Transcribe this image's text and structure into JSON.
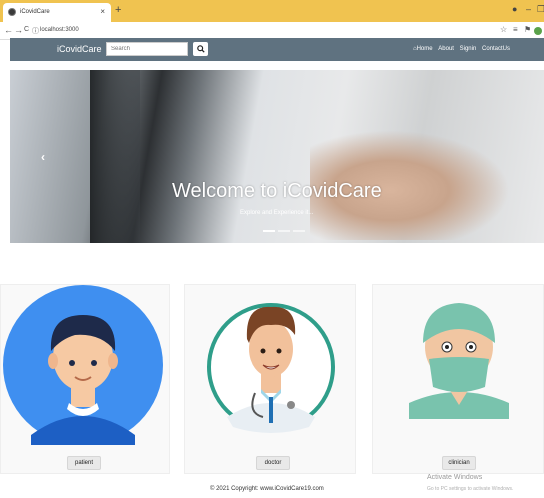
{
  "browser": {
    "tab_title": "iCovidCare",
    "tab_close": "×",
    "new_tab": "+",
    "url": "localhost:3000",
    "back": "←",
    "forward": "→",
    "reload": "C",
    "info": "ⓘ"
  },
  "navbar": {
    "brand": "iCovidCare",
    "search_placeholder": "Search",
    "search_button_icon": "search-icon",
    "links": [
      "Home",
      "About",
      "Signin",
      "ContactUs"
    ],
    "home_icon": "home-icon"
  },
  "carousel": {
    "title": "Welcome to iCovidCare",
    "subtitle": "Explore and Experience it...",
    "prev": "‹"
  },
  "cards": [
    {
      "label": "patient",
      "icon": "patient-avatar-icon"
    },
    {
      "label": "doctor",
      "icon": "doctor-avatar-icon"
    },
    {
      "label": "clinician",
      "icon": "clinician-avatar-icon"
    }
  ],
  "footer": "© 2021 Copyright: www.iCovidCare19.com",
  "os_watermark": {
    "title": "Activate Windows",
    "text": "Go to PC settings to activate Windows."
  },
  "colors": {
    "tabstrip": "#f0c350",
    "navbar": "#5f7280",
    "patient_circle": "#3f8ff0",
    "doctor_ring": "#2f9e8a",
    "scrub": "#79c3ad"
  }
}
